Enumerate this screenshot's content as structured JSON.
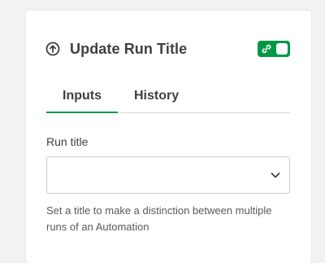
{
  "panel": {
    "title": "Update Run Title",
    "title_icon": "circle-up-arrow-icon",
    "toggle": {
      "icon": "link-icon",
      "enabled": true,
      "color": "#009845"
    }
  },
  "tabs": [
    {
      "label": "Inputs",
      "active": true
    },
    {
      "label": "History",
      "active": false
    }
  ],
  "run_title_field": {
    "label": "Run title",
    "value": "",
    "help_text": "Set a title to make a distinction between multiple runs of an Automation"
  },
  "colors": {
    "accent": "#009845",
    "text": "#404040"
  }
}
